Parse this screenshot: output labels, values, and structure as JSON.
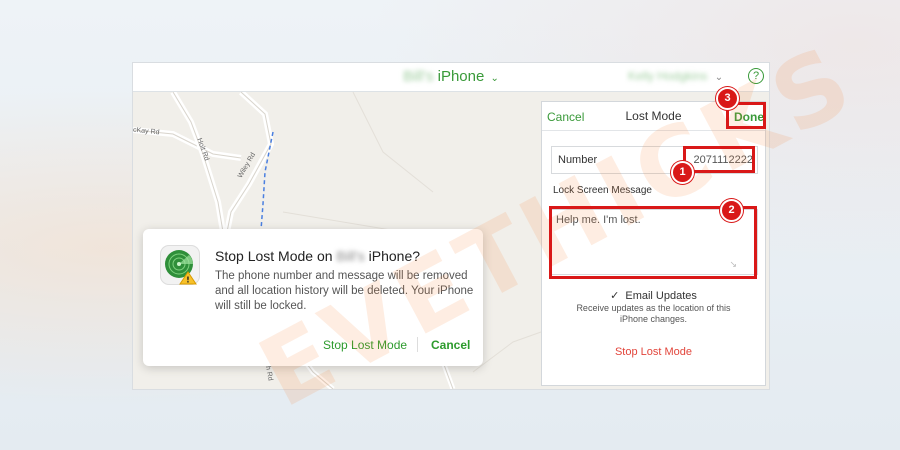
{
  "header": {
    "device_name_blurred": "Bill's",
    "device_name": "iPhone",
    "account_name_blurred": "Kelly Hodgkins",
    "help_label": "?"
  },
  "map": {
    "road_labels": [
      "cKay Rd",
      "Holt Rd",
      "Wiley Rd",
      "ath Rd"
    ]
  },
  "dialog": {
    "title_prefix": "Stop Lost Mode on",
    "title_owner_blurred": "Bill's",
    "title_suffix": "iPhone?",
    "body": "The phone number and message will be removed and all location history will be deleted. Your iPhone will still be locked.",
    "stop_button": "Stop Lost Mode",
    "cancel_button": "Cancel"
  },
  "panel": {
    "cancel": "Cancel",
    "title": "Lost Mode",
    "done": "Done",
    "number_label": "Number",
    "number_value": "2071112222",
    "lock_screen_label": "Lock Screen Message",
    "message": "Help me. I'm lost.",
    "email_updates_label": "Email Updates",
    "email_updates_checked": true,
    "email_updates_desc": "Receive updates as the location of this iPhone changes.",
    "stop_lost_mode": "Stop Lost Mode"
  },
  "annotations": {
    "badges": [
      "1",
      "2",
      "3"
    ],
    "highlight_color": "#d91818"
  },
  "watermark": "EVETHICKS",
  "colors": {
    "accent_green": "#3a9a3a",
    "danger_red": "#e2453b"
  }
}
